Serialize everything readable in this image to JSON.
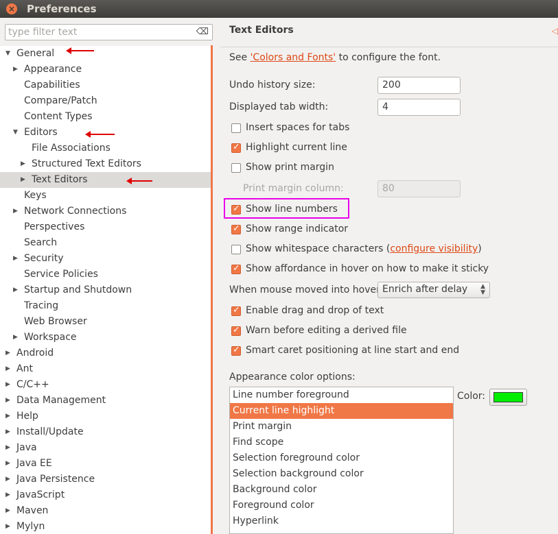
{
  "window": {
    "title": "Preferences",
    "close_glyph": "×"
  },
  "filter": {
    "placeholder": "type filter text",
    "clear_icon": "⌫"
  },
  "tree": [
    {
      "label": "General",
      "depth": 0,
      "arrow": "▼"
    },
    {
      "label": "Appearance",
      "depth": 1,
      "arrow": "▶"
    },
    {
      "label": "Capabilities",
      "depth": 1,
      "arrow": ""
    },
    {
      "label": "Compare/Patch",
      "depth": 1,
      "arrow": ""
    },
    {
      "label": "Content Types",
      "depth": 1,
      "arrow": ""
    },
    {
      "label": "Editors",
      "depth": 1,
      "arrow": "▼"
    },
    {
      "label": "File Associations",
      "depth": 2,
      "arrow": ""
    },
    {
      "label": "Structured Text Editors",
      "depth": 2,
      "arrow": "▶"
    },
    {
      "label": "Text Editors",
      "depth": 2,
      "arrow": "▶",
      "selected": true
    },
    {
      "label": "Keys",
      "depth": 1,
      "arrow": ""
    },
    {
      "label": "Network Connections",
      "depth": 1,
      "arrow": "▶"
    },
    {
      "label": "Perspectives",
      "depth": 1,
      "arrow": ""
    },
    {
      "label": "Search",
      "depth": 1,
      "arrow": ""
    },
    {
      "label": "Security",
      "depth": 1,
      "arrow": "▶"
    },
    {
      "label": "Service Policies",
      "depth": 1,
      "arrow": ""
    },
    {
      "label": "Startup and Shutdown",
      "depth": 1,
      "arrow": "▶"
    },
    {
      "label": "Tracing",
      "depth": 1,
      "arrow": ""
    },
    {
      "label": "Web Browser",
      "depth": 1,
      "arrow": ""
    },
    {
      "label": "Workspace",
      "depth": 1,
      "arrow": "▶"
    },
    {
      "label": "Android",
      "depth": 0,
      "arrow": "▶"
    },
    {
      "label": "Ant",
      "depth": 0,
      "arrow": "▶"
    },
    {
      "label": "C/C++",
      "depth": 0,
      "arrow": "▶"
    },
    {
      "label": "Data Management",
      "depth": 0,
      "arrow": "▶"
    },
    {
      "label": "Help",
      "depth": 0,
      "arrow": "▶"
    },
    {
      "label": "Install/Update",
      "depth": 0,
      "arrow": "▶"
    },
    {
      "label": "Java",
      "depth": 0,
      "arrow": "▶"
    },
    {
      "label": "Java EE",
      "depth": 0,
      "arrow": "▶"
    },
    {
      "label": "Java Persistence",
      "depth": 0,
      "arrow": "▶"
    },
    {
      "label": "JavaScript",
      "depth": 0,
      "arrow": "▶"
    },
    {
      "label": "Maven",
      "depth": 0,
      "arrow": "▶"
    },
    {
      "label": "Mylyn",
      "depth": 0,
      "arrow": "▶"
    }
  ],
  "page": {
    "title": "Text Editors",
    "nav_icon": "◁",
    "font_hint_prefix": "See ",
    "font_hint_link": "'Colors and Fonts'",
    "font_hint_suffix": " to configure the font.",
    "undo_label": "Undo history size:",
    "undo_value": "200",
    "tab_label": "Displayed tab width:",
    "tab_value": "4",
    "insert_spaces": "Insert spaces for tabs",
    "highlight_line": "Highlight current line",
    "show_print_margin": "Show print margin",
    "print_margin_label": "Print margin column:",
    "print_margin_value": "80",
    "show_line_numbers": "Show line numbers",
    "show_range": "Show range indicator",
    "show_ws_prefix": "Show whitespace characters (",
    "show_ws_link": "configure visibility",
    "show_ws_suffix": ")",
    "show_affordance": "Show affordance in hover on how to make it sticky",
    "hover_label": "When mouse moved into hover:",
    "hover_value": "Enrich after delay",
    "drag_drop": "Enable drag and drop of text",
    "warn_derived": "Warn before editing a derived file",
    "smart_caret": "Smart caret positioning at line start and end",
    "appearance_label": "Appearance color options:",
    "color_label": "Color:",
    "color_value": "#00ee00",
    "color_options": [
      "Line number foreground",
      "Current line highlight",
      "Print margin",
      "Find scope",
      "Selection foreground color",
      "Selection background color",
      "Background color",
      "Foreground color",
      "Hyperlink"
    ],
    "selected_color_option": 1
  },
  "checkboxes": {
    "insert_spaces": false,
    "highlight_line": true,
    "show_print_margin": false,
    "show_line_numbers": true,
    "show_range": true,
    "show_ws": false,
    "show_affordance": true,
    "drag_drop": true,
    "warn_derived": true,
    "smart_caret": true
  },
  "colors": {
    "accent": "#f07746",
    "link": "#dd4814",
    "annotation_red": "#e00000",
    "highlight_magenta": "#ea00ea"
  }
}
